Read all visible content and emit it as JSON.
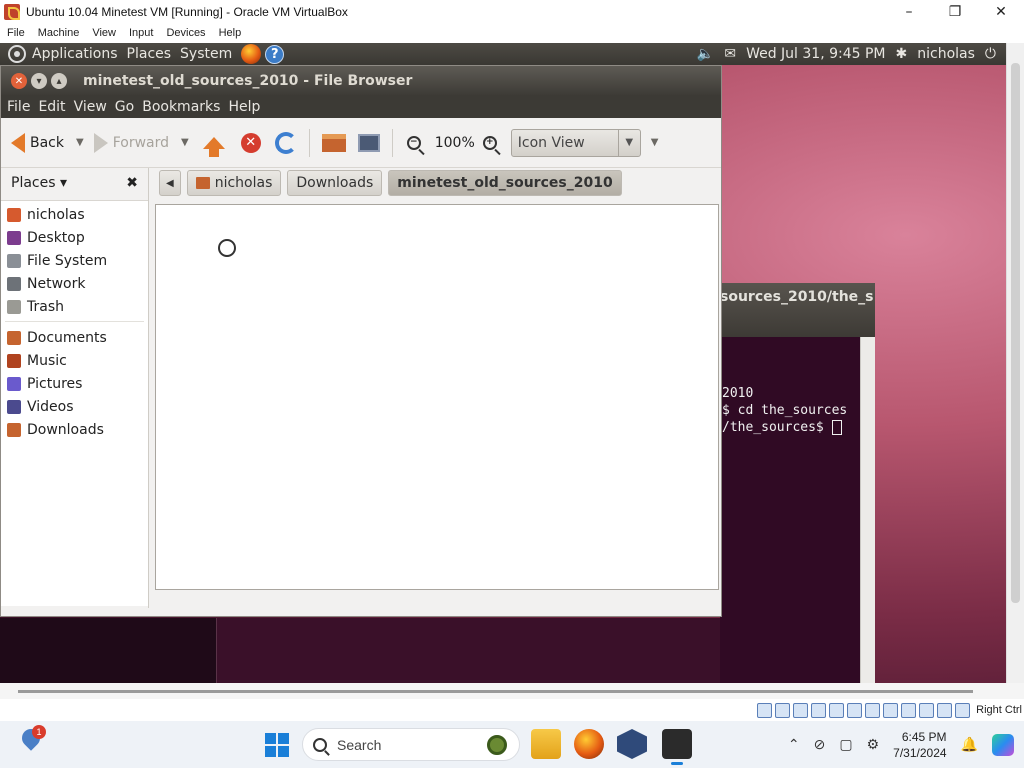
{
  "host": {
    "title": "Ubuntu 10.04 Minetest VM [Running] - Oracle VM VirtualBox",
    "menu": [
      "File",
      "Machine",
      "View",
      "Input",
      "Devices",
      "Help"
    ],
    "window_buttons": {
      "minimize": "–",
      "maximize": "❐",
      "close": "✕"
    },
    "status_key": "Right Ctrl"
  },
  "ubuntu_panel": {
    "menus": [
      "Applications",
      "Places",
      "System"
    ],
    "datetime": "Wed Jul 31,  9:45 PM",
    "user": "nicholas"
  },
  "file_browser": {
    "title": "minetest_old_sources_2010 - File Browser",
    "menu": [
      "File",
      "Edit",
      "View",
      "Go",
      "Bookmarks",
      "Help"
    ],
    "toolbar": {
      "back": "Back",
      "forward": "Forward",
      "zoom": "100%",
      "view_mode": "Icon View"
    },
    "sidebar": {
      "header": "Places ▾",
      "places": [
        {
          "label": "nicholas",
          "color": "#d65a2e"
        },
        {
          "label": "Desktop",
          "color": "#7c3c8e"
        },
        {
          "label": "File System",
          "color": "#8a8f96"
        },
        {
          "label": "Network",
          "color": "#6d7278"
        },
        {
          "label": "Trash",
          "color": "#9a9a94"
        }
      ],
      "bookmarks": [
        {
          "label": "Documents",
          "color": "#c5642f"
        },
        {
          "label": "Music",
          "color": "#b0431f"
        },
        {
          "label": "Pictures",
          "color": "#6a5acd"
        },
        {
          "label": "Videos",
          "color": "#4b4a8e"
        },
        {
          "label": "Downloads",
          "color": "#c5642f"
        }
      ]
    },
    "breadcrumbs": [
      "nicholas",
      "Downloads",
      "minetest_old_sources_2010"
    ]
  },
  "terminal": {
    "title_fragment": "sources_2010/the_s",
    "lines": [
      "2010",
      "$ cd the_sources",
      "/the_sources$ "
    ]
  },
  "taskbar": {
    "weather_badge": "1",
    "search_placeholder": "Search",
    "clock_time": "6:45 PM",
    "clock_date": "7/31/2024"
  }
}
